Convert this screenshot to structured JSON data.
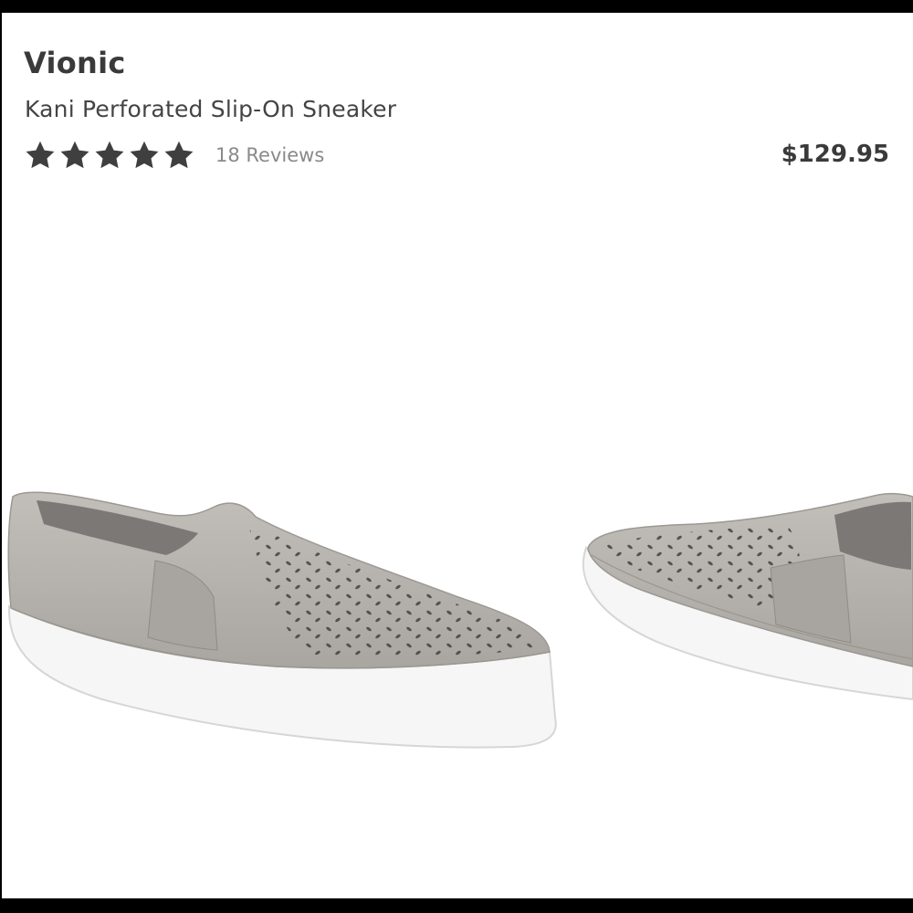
{
  "product": {
    "brand": "Vionic",
    "name": "Kani Perforated Slip-On Sneaker",
    "rating": 5,
    "rating_max": 5,
    "reviews_label": "18 Reviews",
    "price": "$129.95"
  },
  "icons": {
    "star": "star-icon"
  },
  "colors": {
    "text_dark": "#3a3a3a",
    "text_muted": "#8a8a8a",
    "shoe_suede": "#b7b3ae",
    "sole": "#f7f7f7"
  }
}
